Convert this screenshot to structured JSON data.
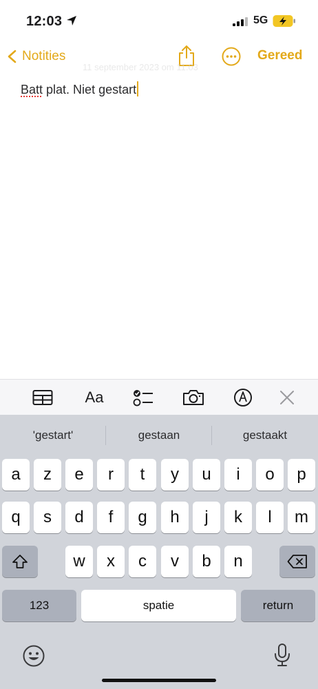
{
  "status_bar": {
    "time": "12:03",
    "network": "5G",
    "icons": [
      "location-arrow-icon",
      "signal-icon",
      "battery-charging-icon"
    ]
  },
  "nav": {
    "back_label": "Notities",
    "done_label": "Gereed",
    "ghost_text": "11 september 2023 om 11:03",
    "icons": [
      "chevron-left-icon",
      "share-icon",
      "more-icon"
    ]
  },
  "note": {
    "misspelled_word": "Batt",
    "rest_text": " plat. Niet gestart"
  },
  "toolbar": {
    "format_label": "Aa",
    "icons": [
      "table-icon",
      "format-icon",
      "checklist-icon",
      "camera-icon",
      "markup-icon",
      "close-icon"
    ]
  },
  "keyboard": {
    "suggestions": [
      "'gestart'",
      "gestaan",
      "gestaakt"
    ],
    "row1": [
      "a",
      "z",
      "e",
      "r",
      "t",
      "y",
      "u",
      "i",
      "o",
      "p"
    ],
    "row2": [
      "q",
      "s",
      "d",
      "f",
      "g",
      "h",
      "j",
      "k",
      "l",
      "m"
    ],
    "row3": [
      "w",
      "x",
      "c",
      "v",
      "b",
      "n"
    ],
    "numbers_label": "123",
    "space_label": "spatie",
    "return_label": "return",
    "icons": [
      "shift-icon",
      "backspace-icon",
      "emoji-icon",
      "microphone-icon"
    ]
  },
  "colors": {
    "accent": "#e3a91a",
    "keyboard_bg": "#d1d4da",
    "key": "#ffffff",
    "key_dark": "#abb0bb"
  }
}
